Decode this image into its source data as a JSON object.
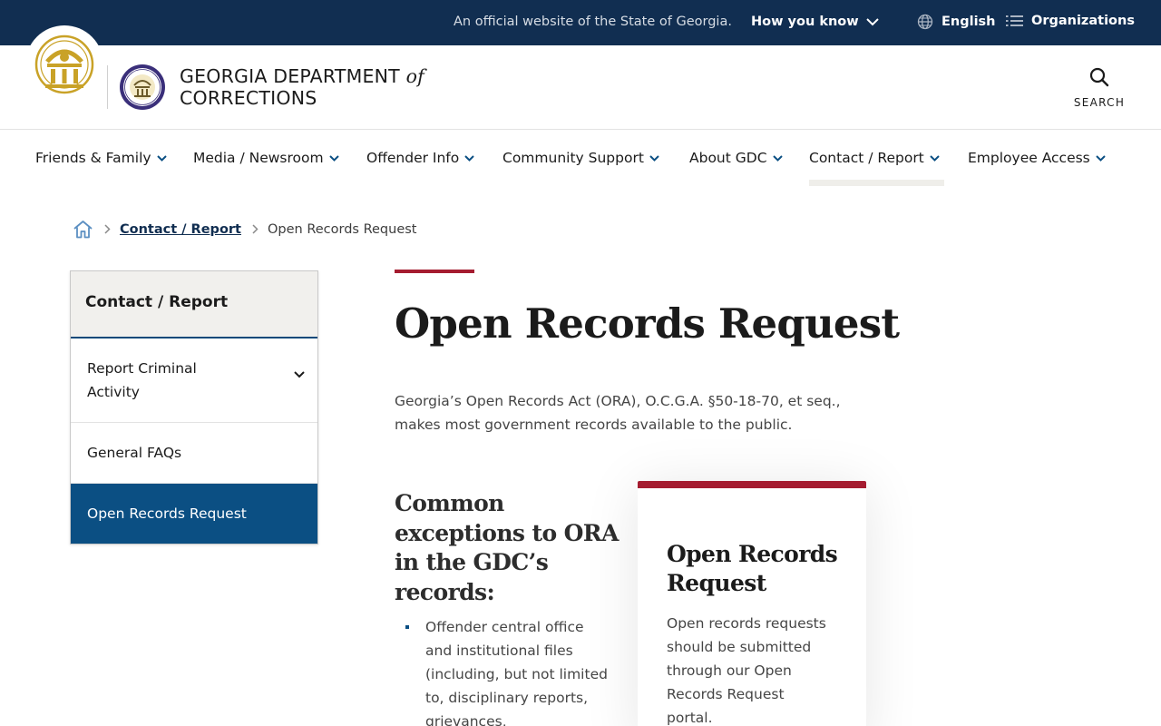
{
  "top_bar": {
    "official_text": "An official website of the State of Georgia.",
    "how_you_know": "How you know",
    "language": "English",
    "organizations": "Organizations"
  },
  "header": {
    "brand_line1": "GEORGIA DEPARTMENT",
    "brand_of": "of",
    "brand_line2": "CORRECTIONS",
    "search_label": "SEARCH"
  },
  "nav": {
    "items": [
      {
        "label": "Friends & Family"
      },
      {
        "label": "Media / Newsroom"
      },
      {
        "label": "Offender Info"
      },
      {
        "label": "Community Support"
      },
      {
        "label": "About GDC"
      },
      {
        "label": "Contact / Report"
      },
      {
        "label": "Employee Access"
      }
    ],
    "active": "Contact / Report"
  },
  "breadcrumb": {
    "parent": "Contact / Report",
    "current": "Open Records Request"
  },
  "side_nav": {
    "heading": "Contact / Report",
    "items": [
      {
        "label": "Report Criminal Activity"
      },
      {
        "label": "General FAQs"
      },
      {
        "label": "Open Records Request"
      }
    ]
  },
  "main": {
    "title": "Open Records Request",
    "intro": "Georgia’s Open Records Act (ORA), O.C.G.A. §50-18-70, et seq., makes most government records available to the public.",
    "exceptions_title": "Common exceptions to ORA in the GDC’s records:",
    "exceptions": [
      "Offender central office and institutional files (including, but not limited to, disciplinary reports, grievances,"
    ]
  },
  "card": {
    "title": "Open Records Request",
    "body": "Open records requests should be submitted through our Open Records Request portal."
  },
  "colors": {
    "top_bar_bg": "#112e51",
    "accent_red": "#a51c30",
    "active_blue": "#0b4f83",
    "gold": "#c9a227"
  }
}
